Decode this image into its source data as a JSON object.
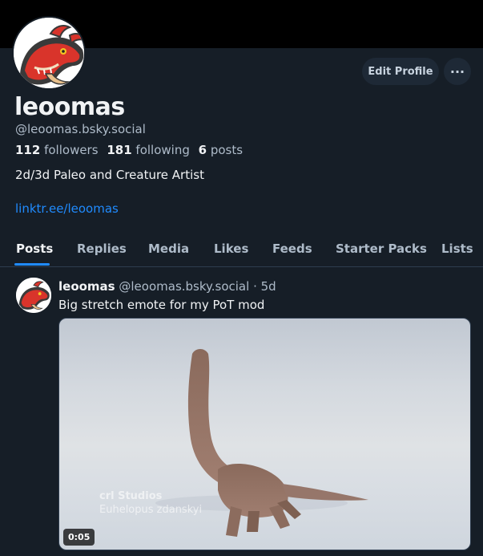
{
  "profile": {
    "display_name": "leoomas",
    "handle": "@leoomas.bsky.social",
    "followers_count": "112",
    "followers_label": "followers",
    "following_count": "181",
    "following_label": "following",
    "posts_count": "6",
    "posts_label": "posts",
    "bio": "2d/3d Paleo and Creature Artist",
    "link": "linktr.ee/leoomas",
    "avatar_icon": "red-dragon-avatar-icon"
  },
  "actions": {
    "edit_profile_label": "Edit Profile",
    "more_label": "···"
  },
  "tabs": [
    {
      "label": "Posts",
      "active": true
    },
    {
      "label": "Replies"
    },
    {
      "label": "Media"
    },
    {
      "label": "Likes"
    },
    {
      "label": "Feeds"
    },
    {
      "label": "Starter Packs"
    },
    {
      "label": "Lists"
    }
  ],
  "post": {
    "author": "leoomas",
    "handle": "@leoomas.bsky.social",
    "separator": " · ",
    "time": "5d",
    "text": "Big stretch emote for my PoT mod",
    "video": {
      "duration": "0:05",
      "watermark_studio": "crl Studios",
      "watermark_species": "Euhelopus zdanskyi"
    }
  },
  "colors": {
    "background": "#161e27",
    "accent": "#208bfe",
    "muted_text": "#aebbc9"
  }
}
